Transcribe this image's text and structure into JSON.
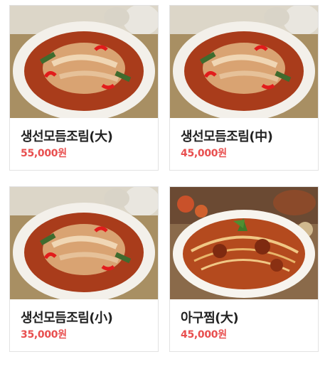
{
  "products": [
    {
      "name": "생선모듬조림(大)",
      "price": "55,000원",
      "image": "braised-fish-dish"
    },
    {
      "name": "생선모듬조림(中)",
      "price": "45,000원",
      "image": "braised-fish-dish"
    },
    {
      "name": "생선모듬조림(小)",
      "price": "35,000원",
      "image": "braised-fish-dish"
    },
    {
      "name": "아구찜(大)",
      "price": "45,000원",
      "image": "braised-monkfish-dish"
    }
  ],
  "colors": {
    "price": "#e84f4f",
    "name": "#222222",
    "border": "#e2e2e2"
  }
}
